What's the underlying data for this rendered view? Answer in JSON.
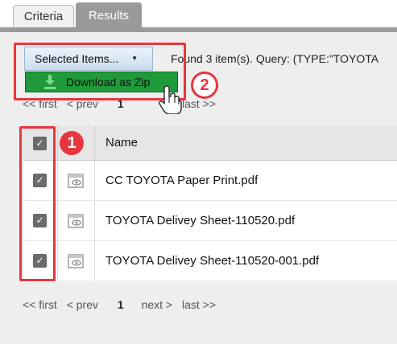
{
  "tabs": [
    {
      "label": "Criteria",
      "active": false
    },
    {
      "label": "Results",
      "active": true
    }
  ],
  "toolbar": {
    "selected_items_label": "Selected Items...",
    "found_text": "Found 3 item(s). Query: (TYPE:\"TOYOTA"
  },
  "menu": {
    "download_zip_label": "Download as Zip"
  },
  "pager": {
    "first": "<< first",
    "prev": "< prev",
    "current": "1",
    "next": "next >",
    "last": "last >>"
  },
  "table": {
    "header_name": "Name",
    "rows": [
      {
        "name": "CC TOYOTA Paper Print.pdf",
        "checked": true
      },
      {
        "name": "TOYOTA Delivey Sheet-110520.pdf",
        "checked": true
      },
      {
        "name": "TOYOTA Delivey Sheet-110520-001.pdf",
        "checked": true
      }
    ]
  },
  "annotations": {
    "step1": "1",
    "step2": "2"
  },
  "colors": {
    "accent_red": "#e8363f",
    "download_green": "#1e9a3a",
    "active_tab": "#9a9a9a"
  }
}
